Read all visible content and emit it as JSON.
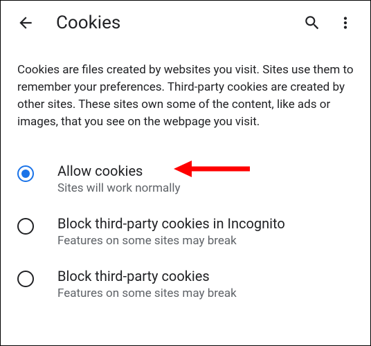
{
  "header": {
    "title": "Cookies"
  },
  "description": "Cookies are files created by websites you visit. Sites use them to remember your preferences. Third-party cookies are created by other sites. These sites own some of the content, like ads or images, that you see on the webpage you visit.",
  "options": [
    {
      "label": "Allow cookies",
      "sublabel": "Sites will work normally",
      "selected": true
    },
    {
      "label": "Block third-party cookies in Incognito",
      "sublabel": "Features on some sites may break",
      "selected": false
    },
    {
      "label": "Block third-party cookies",
      "sublabel": "Features on some sites may break",
      "selected": false
    }
  ]
}
